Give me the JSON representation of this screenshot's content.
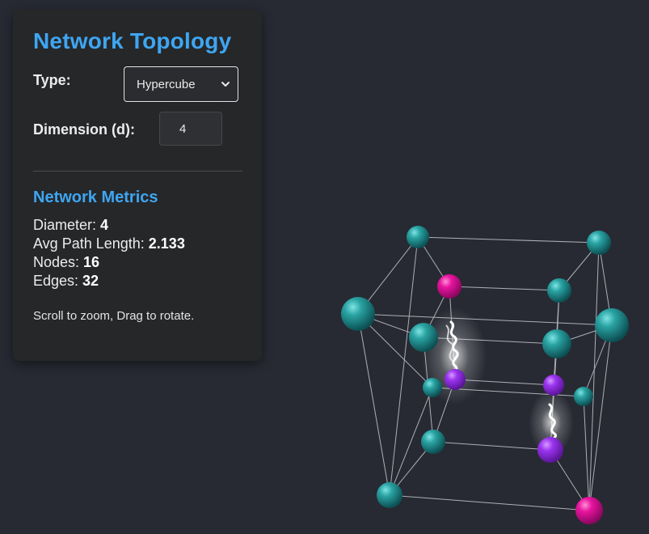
{
  "panel": {
    "title": "Network Topology",
    "type_label": "Type:",
    "type_value": "Hypercube",
    "dimension_label": "Dimension (d):",
    "dimension_value": "4",
    "metrics_title": "Network Metrics",
    "metrics": {
      "diameter_label": "Diameter:",
      "diameter_value": "4",
      "avg_path_label": "Avg Path Length:",
      "avg_path_value": "2.133",
      "nodes_label": "Nodes:",
      "nodes_value": "16",
      "edges_label": "Edges:",
      "edges_value": "32"
    },
    "hint": "Scroll to zoom, Drag to rotate."
  },
  "colors": {
    "background": "#272a33",
    "accent": "#3ea6f2",
    "node_default": "#1f8f8f",
    "node_endpoint": "#e0139e",
    "node_path": "#9b34f0",
    "edge": "#bfc3c8",
    "packet_glow": "#ffffff"
  }
}
